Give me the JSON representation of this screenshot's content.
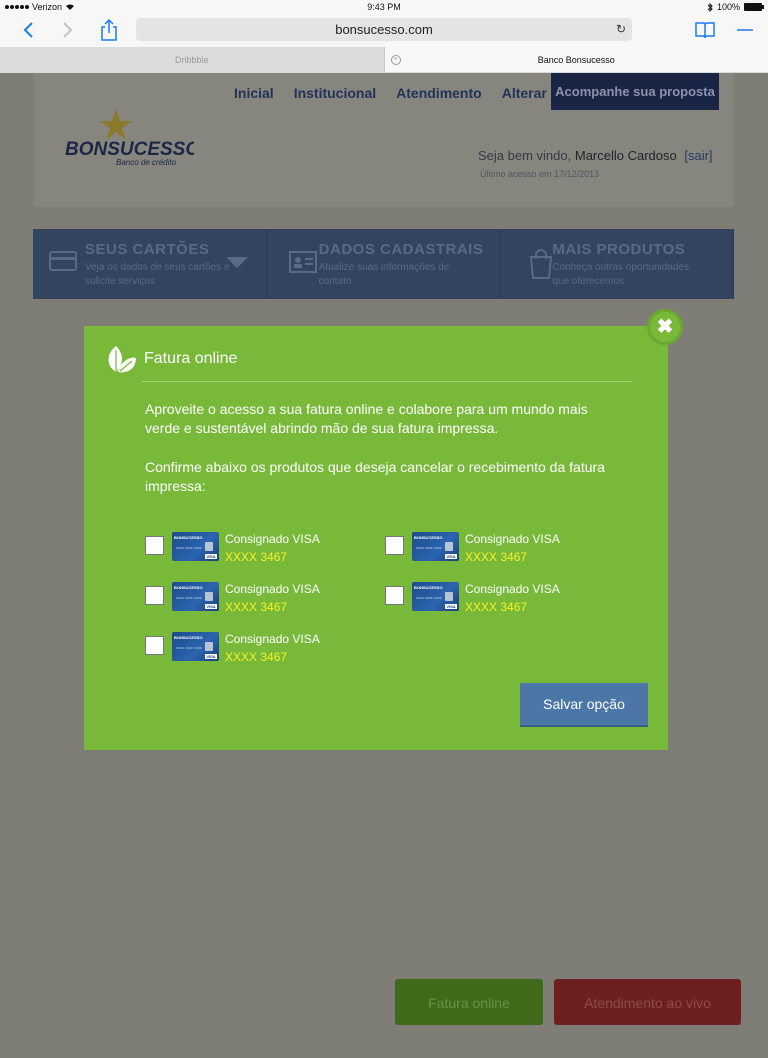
{
  "status_bar": {
    "carrier": "Verizon",
    "time": "9:43 PM",
    "battery": "100%"
  },
  "browser": {
    "url": "bonsucesso.com",
    "tabs": [
      {
        "label": "Dribbble",
        "active": false
      },
      {
        "label": "Banco Bonsucesso",
        "active": true
      }
    ]
  },
  "site": {
    "nav": [
      "Inicial",
      "Institucional",
      "Atendimento",
      "Alterar senha"
    ],
    "proposal_button": "Acompanhe sua proposta",
    "logo": {
      "brand": "BONSUCESSO",
      "tagline": "Banco de crédito"
    },
    "welcome_prefix": "Seja bem vindo,",
    "user_name": "Marcello Cardoso",
    "logout": "[sair]",
    "last_access_label": "Último acesso em",
    "last_access_date": "17/12/2013",
    "menu": [
      {
        "title": "SEUS CARTÕES",
        "subtitle": "Veja os dados de seus cartões e solicite serviços",
        "icon": "credit-card-icon"
      },
      {
        "title": "DADOS CADASTRAIS",
        "subtitle": "Atualize suas informações de contato",
        "icon": "id-card-icon"
      },
      {
        "title": "MAIS PRODUTOS",
        "subtitle": "Conheça outras oportunidades que oferecemos",
        "icon": "shopping-bag-icon"
      }
    ],
    "floating_buttons": {
      "fatura": "Fatura online",
      "atendimento": "Atendimento ao vivo"
    }
  },
  "modal": {
    "title": "Fatura online",
    "paragraph1": "Aproveite o acesso a sua fatura online e colabore para um mundo mais verde e sustentável abrindo mão de sua fatura impressa.",
    "paragraph2": "Confirme abaixo os produtos que deseja cancelar o recebimento da fatura impressa:",
    "products": [
      {
        "name": "Consignado VISA",
        "number": "XXXX 3467",
        "checked": false
      },
      {
        "name": "Consignado VISA",
        "number": "XXXX 3467",
        "checked": false
      },
      {
        "name": "Consignado VISA",
        "number": "XXXX 3467",
        "checked": false
      },
      {
        "name": "Consignado VISA",
        "number": "XXXX 3467",
        "checked": false
      },
      {
        "name": "Consignado VISA",
        "number": "XXXX 3467",
        "checked": false
      }
    ],
    "save_button": "Salvar opção"
  },
  "colors": {
    "modal_green": "#78b93a",
    "number_yellow": "#f4f226",
    "save_blue": "#4b76a8",
    "overlay": "#7c7c74"
  }
}
